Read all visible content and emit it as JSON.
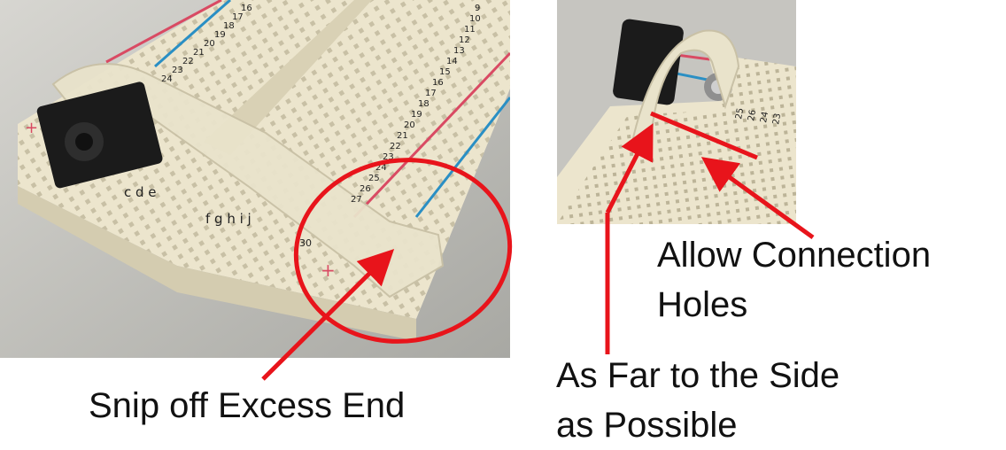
{
  "captions": {
    "snip": "Snip off Excess End",
    "allow_line1": "Allow Connection",
    "allow_line2": "Holes",
    "far_line1": "As Far to the Side",
    "far_line2": "as Possible"
  },
  "breadboard_labels": {
    "row_numbers_left": [
      "16",
      "17",
      "18",
      "19",
      "20",
      "21",
      "22",
      "23",
      "24"
    ],
    "row_numbers_right": [
      "9",
      "10",
      "11",
      "12",
      "13",
      "14",
      "15",
      "16",
      "17",
      "18",
      "19",
      "20",
      "21",
      "22",
      "23",
      "24",
      "25",
      "26",
      "27"
    ],
    "row_numbers_bottom": "30",
    "columns_top": "c d e",
    "columns_bottom": "f g h i j",
    "plus_sign": "+",
    "right_photo_numbers": [
      "25",
      "26",
      "24",
      "23"
    ]
  },
  "colors": {
    "annotation_red": "#e8141b",
    "rail_red": "#d94a63",
    "rail_blue": "#2a8fc4",
    "board": "#efe9d3",
    "background": "#c9c9c4"
  }
}
